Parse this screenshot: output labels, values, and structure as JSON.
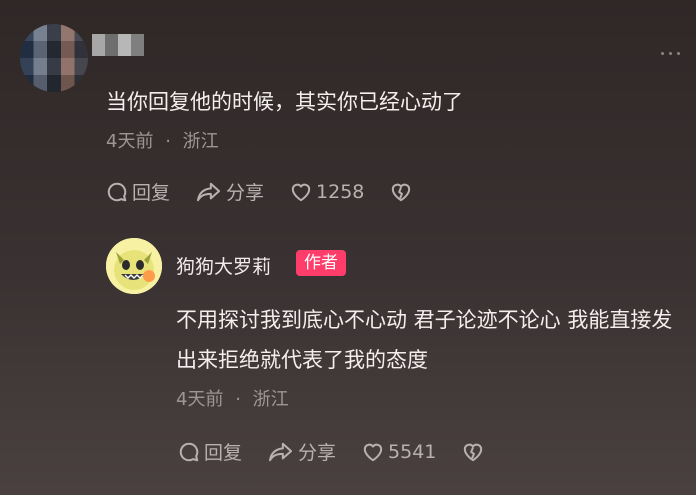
{
  "comment": {
    "text": "当你回复他的时候，其实你已经心动了",
    "time": "4天前",
    "separator": "·",
    "location": "浙江",
    "reply_label": "回复",
    "share_label": "分享",
    "like_count": "1258"
  },
  "reply": {
    "username": "狗狗大罗莉",
    "author_badge": "作者",
    "text": "不用探讨我到底心不心动 君子论迹不论心 我能直接发出来拒绝就代表了我的态度",
    "time": "4天前",
    "separator": "·",
    "location": "浙江",
    "reply_label": "回复",
    "share_label": "分享",
    "like_count": "5541"
  },
  "colors": {
    "badge": "#ff3d6a",
    "avatar_bg": "#f7f1a4"
  }
}
